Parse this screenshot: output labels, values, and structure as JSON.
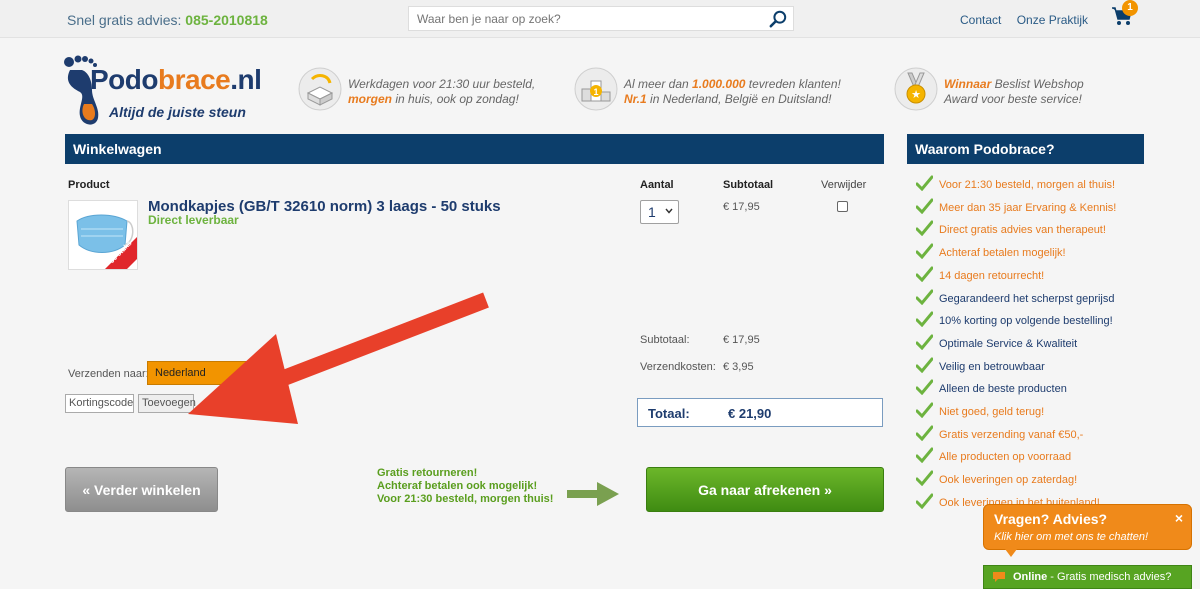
{
  "topbar": {
    "advice_prefix": "Snel gratis advies:",
    "phone": "085-2010818",
    "search_placeholder": "Waar ben je naar op zoek?",
    "links": [
      "Contact",
      "Onze Praktijk"
    ],
    "cart_count": "1"
  },
  "header": {
    "logo_part1": "Podo",
    "logo_part2": "brace",
    "logo_part3": ".nl",
    "tagline": "Altijd de juiste steun",
    "usps": [
      {
        "icon": "box-icon",
        "line1": "Werkdagen voor 21:30 uur besteld,",
        "line2_hl": "morgen",
        "line2": " in huis, ook op zondag!"
      },
      {
        "icon": "podium-icon",
        "line1_pre": "Al meer dan ",
        "line1_hl": "1.000.000",
        "line1_post": " tevreden klanten!",
        "line2_hl": "Nr.1",
        "line2": " in Nederland, België en Duitsland!"
      },
      {
        "icon": "medal-icon",
        "line1_hl": "Winnaar",
        "line1_post": " Beslist Webshop",
        "line2": "Award voor beste service!"
      }
    ]
  },
  "cart": {
    "title": "Winkelwagen",
    "columns": {
      "product": "Product",
      "quantity": "Aantal",
      "subtotal": "Subtotaal",
      "remove": "Verwijder"
    },
    "item": {
      "name": "Mondkapjes (GB/T 32610 norm) 3 laags - 50 stuks",
      "stock": "Direct leverbaar",
      "image_badge": "50 stuks",
      "quantity": "1",
      "subtotal": "€ 17,95"
    },
    "summary": {
      "subtotal_label": "Subtotaal:",
      "subtotal_value": "€ 17,95",
      "shipping_label": "Verzendkosten:",
      "shipping_value": "€ 3,95",
      "total_label": "Totaal:",
      "total_value": "€ 21,90"
    },
    "shipping_to_label": "Verzenden naar:",
    "shipping_country": "Nederland",
    "coupon_placeholder": "Kortingscode",
    "coupon_button": "Toevoegen",
    "continue_button": "« Verder winkelen",
    "promo_lines": [
      "Gratis retourneren!",
      "Achteraf betalen ook mogelijk!",
      "Voor 21:30 besteld, morgen thuis!"
    ],
    "checkout_button": "Ga naar afrekenen »"
  },
  "sidebar": {
    "title": "Waarom Podobrace?",
    "items": [
      {
        "text": "Voor 21:30 besteld, morgen al thuis!",
        "color": "orange"
      },
      {
        "text": "Meer dan 35 jaar Ervaring & Kennis!",
        "color": "orange"
      },
      {
        "text": "Direct gratis advies van therapeut!",
        "color": "orange"
      },
      {
        "text": "Achteraf betalen mogelijk!",
        "color": "orange"
      },
      {
        "text": "14 dagen retourrecht!",
        "color": "orange"
      },
      {
        "text": "Gegarandeerd het scherpst geprijsd",
        "color": "blue"
      },
      {
        "text": "10% korting op volgende bestelling!",
        "color": "blue"
      },
      {
        "text": "Optimale Service & Kwaliteit",
        "color": "blue"
      },
      {
        "text": "Veilig en betrouwbaar",
        "color": "blue"
      },
      {
        "text": "Alleen de beste producten",
        "color": "blue"
      },
      {
        "text": "Niet goed, geld terug!",
        "color": "orange"
      },
      {
        "text": "Gratis verzending vanaf €50,-",
        "color": "orange"
      },
      {
        "text": "Alle producten op voorraad",
        "color": "orange"
      },
      {
        "text": "Ook leveringen op zaterdag!",
        "color": "orange"
      },
      {
        "text": "Ook leveringen in het buitenland!",
        "color": "orange"
      }
    ]
  },
  "chat": {
    "title": "Vragen? Advies?",
    "subtitle": "Klik hier om met ons te chatten!",
    "close": "×",
    "online_label": "Online",
    "online_text": " - Gratis medisch advies?"
  },
  "colors": {
    "navy": "#0c3e6b",
    "orange": "#e87b1e",
    "green": "#6db33f",
    "arrow_red": "#e8402a"
  }
}
